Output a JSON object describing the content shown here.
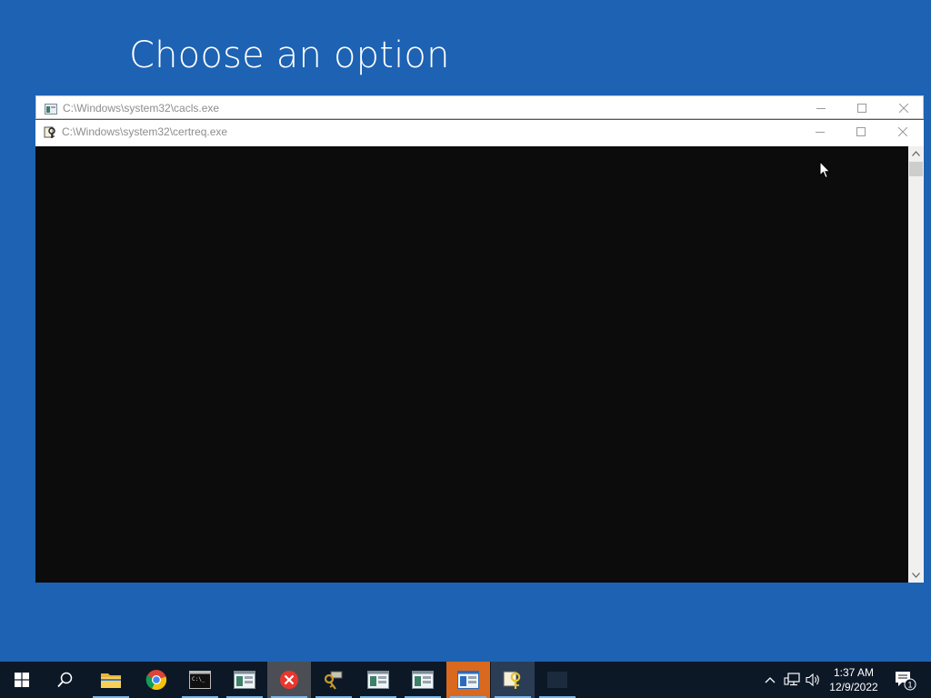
{
  "screen": {
    "heading": "Choose an option"
  },
  "windows": {
    "back": {
      "title": "C:\\Windows\\system32\\cacls.exe"
    },
    "front": {
      "title": "C:\\Windows\\system32\\certreq.exe"
    }
  },
  "taskbar": {
    "apps": [
      "start-icon",
      "search-icon",
      "file-explorer-icon",
      "chrome-icon",
      "cmd-icon",
      "console-window-icon",
      "error-x-icon",
      "key-tool-icon",
      "console-window-icon",
      "console-window-icon",
      "console-window-icon",
      "cert-key-icon",
      "blank-window-icon"
    ],
    "clock": {
      "time": "1:37 AM",
      "date": "12/9/2022"
    },
    "notifications": {
      "count": "1"
    }
  },
  "colors": {
    "desktop": "#1d62b3",
    "taskbar": "#0d1827",
    "console_bg": "#0c0c0c",
    "flash": "#d8691e"
  }
}
